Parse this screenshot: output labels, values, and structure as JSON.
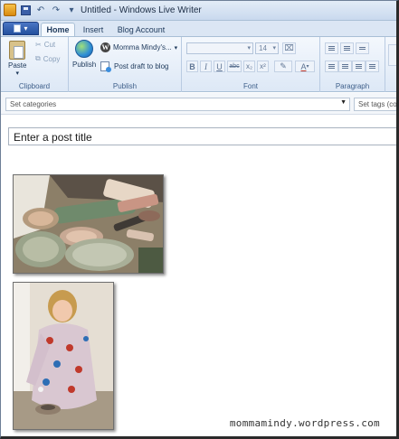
{
  "window": {
    "title": "Untitled - Windows Live Writer"
  },
  "tabs": [
    {
      "label": "Home",
      "active": true
    },
    {
      "label": "Insert",
      "active": false
    },
    {
      "label": "Blog Account",
      "active": false
    }
  ],
  "ribbon": {
    "clipboard": {
      "label": "Clipboard",
      "paste": "Paste",
      "cut": "Cut",
      "copy": "Copy"
    },
    "publish": {
      "label": "Publish",
      "publish_button": "Publish",
      "blog_name": "Momma Mindy's...",
      "draft": "Post draft to blog"
    },
    "font": {
      "label": "Font",
      "font_name": "",
      "font_size": "14",
      "bold": "B",
      "italic": "I",
      "underline": "U",
      "strike": "abc",
      "subscript": "x₂",
      "superscript": "x²"
    },
    "paragraph": {
      "label": "Paragraph"
    }
  },
  "categories": {
    "placeholder": "Set categories"
  },
  "tags": {
    "placeholder": "Set tags (com"
  },
  "post": {
    "title_placeholder": "Enter a post title"
  },
  "watermark": "mommamindy.wordpress.com",
  "colors": {
    "accent": "#2a5aa8",
    "ribbon": "#dde8f6"
  }
}
